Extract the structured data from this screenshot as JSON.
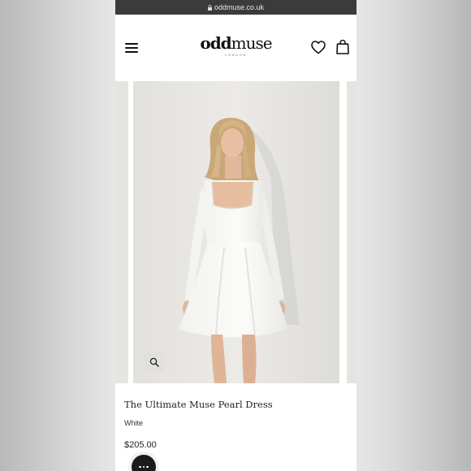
{
  "browser": {
    "url": "oddmuse.co.uk"
  },
  "header": {
    "logo_bold": "odd",
    "logo_light": "muse",
    "logo_sub": "LONDON"
  },
  "icons": {
    "menu": "hamburger-menu-icon",
    "wishlist": "heart-icon",
    "cart": "shopping-bag-icon",
    "zoom": "search-icon",
    "chat": "chat-bubble-icon",
    "lock": "lock-icon"
  },
  "product": {
    "title": "The Ultimate Muse Pearl Dress",
    "color": "White",
    "price": "$205.00",
    "image": "model-in-white-dress"
  },
  "colors": {
    "url_bar": "#3b3b3b",
    "text": "#222222",
    "chat_button": "#1b1b1b"
  }
}
